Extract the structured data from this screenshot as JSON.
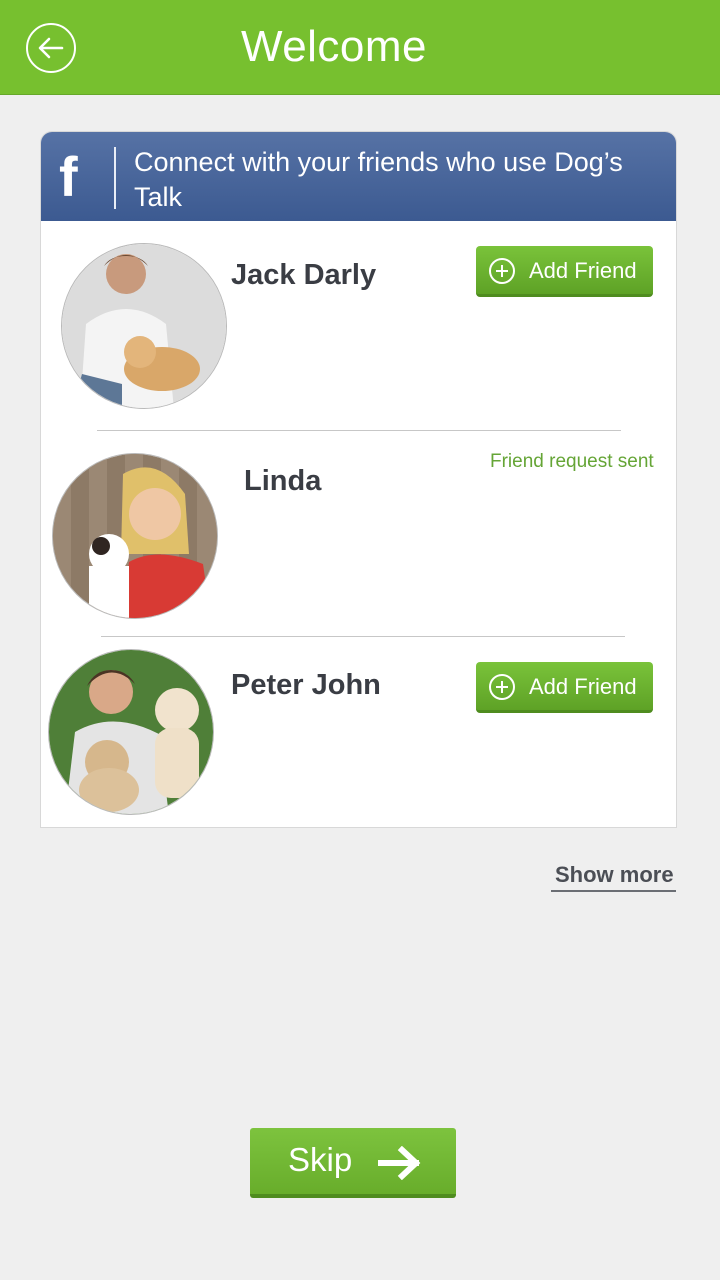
{
  "header": {
    "title": "Welcome",
    "back_icon": "arrow-left-circle-icon",
    "color": "#77c02f"
  },
  "facebook_banner": {
    "icon": "facebook-icon",
    "text": "Connect with your friends who use Dog’s Talk",
    "color": "#3c5a91"
  },
  "friends": [
    {
      "name": "Jack Darly",
      "action_label": "Add Friend",
      "status": ""
    },
    {
      "name": "Linda",
      "action_label": "",
      "status": "Friend request sent"
    },
    {
      "name": "Peter John",
      "action_label": "Add Friend",
      "status": ""
    }
  ],
  "show_more_label": "Show more",
  "skip_label": "Skip",
  "accent_color": "#77c02f",
  "status_color": "#65a536"
}
